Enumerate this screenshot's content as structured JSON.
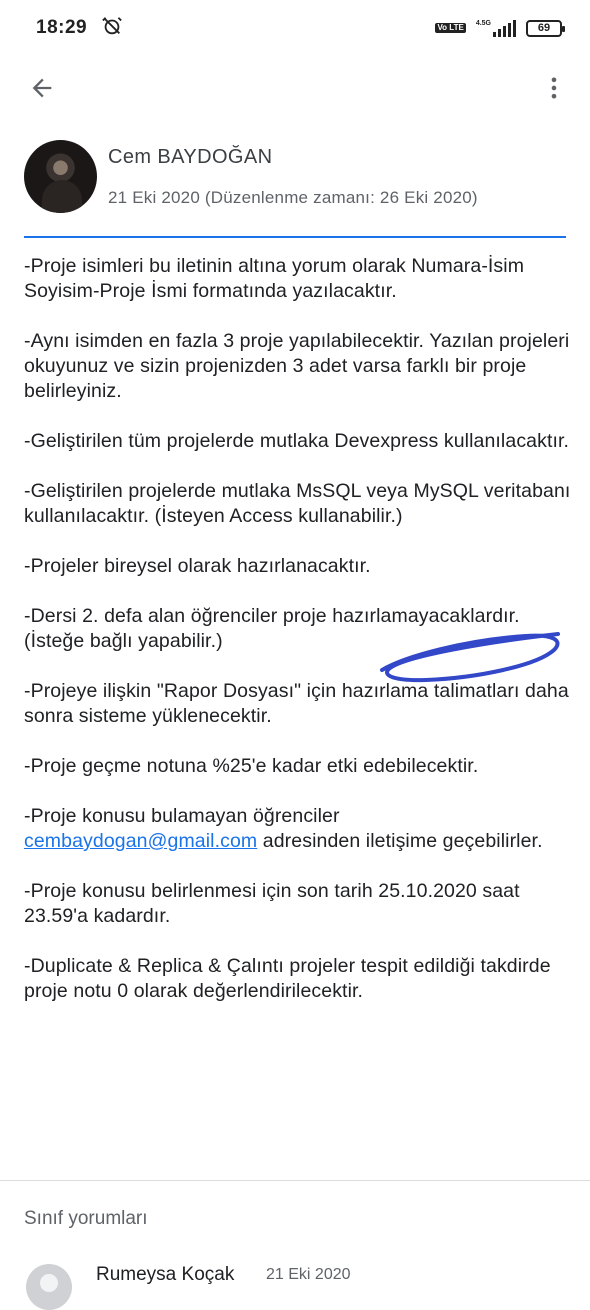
{
  "status_bar": {
    "time": "18:29",
    "network_label": "4.5G",
    "volte_label": "Vo LTE",
    "battery": "69"
  },
  "app_bar": {
    "back_icon": "arrow-back-icon",
    "more_icon": "more-vert-icon"
  },
  "post": {
    "author_name": "Cem BAYDOĞAN",
    "date": "21 Eki 2020 (Düzenlenme zamanı: 26 Eki 2020)",
    "paragraphs": [
      "-Proje isimleri bu iletinin altına yorum olarak Numara-İsim Soyisim-Proje İsmi formatında yazılacaktır.",
      "-Aynı isimden en fazla 3 proje yapılabilecektir. Yazılan projeleri okuyunuz ve sizin projenizden 3 adet varsa farklı bir proje belirleyiniz.",
      "-Geliştirilen tüm projelerde mutlaka Devexpress kullanılacaktır.",
      "-Geliştirilen projelerde mutlaka MsSQL veya MySQL veritabanı kullanılacaktır. (İsteyen Access kullanabilir.)",
      "-Projeler bireysel olarak hazırlanacaktır.",
      "-Dersi 2. defa alan öğrenciler proje hazırlamayacaklardır. (İsteğe bağlı yapabilir.)",
      "-Projeye ilişkin \"Rapor Dosyası\" için hazırlama talimatları daha sonra sisteme yüklenecektir.",
      "-Proje geçme notuna %25'e kadar etki edebilecektir."
    ],
    "contact_prefix": "-Proje konusu bulamayan öğrenciler",
    "contact_email": "cembaydogan@gmail.com",
    "contact_suffix": "adresinden iletişime geçebilirler.",
    "deadline": "-Proje konusu belirlenmesi için son tarih 25.10.2020 saat 23.59'a kadardır.",
    "plagiarism": "-Duplicate & Replica & Çalıntı projeler tespit edildiği takdirde proje notu 0 olarak değerlendirilecektir."
  },
  "comments": {
    "title": "Sınıf yorumları",
    "items": [
      {
        "name": "Rumeysa Koçak",
        "date": "21 Eki 2020"
      }
    ]
  },
  "colors": {
    "accent": "#1a73e8",
    "scribble": "#3347c9"
  }
}
